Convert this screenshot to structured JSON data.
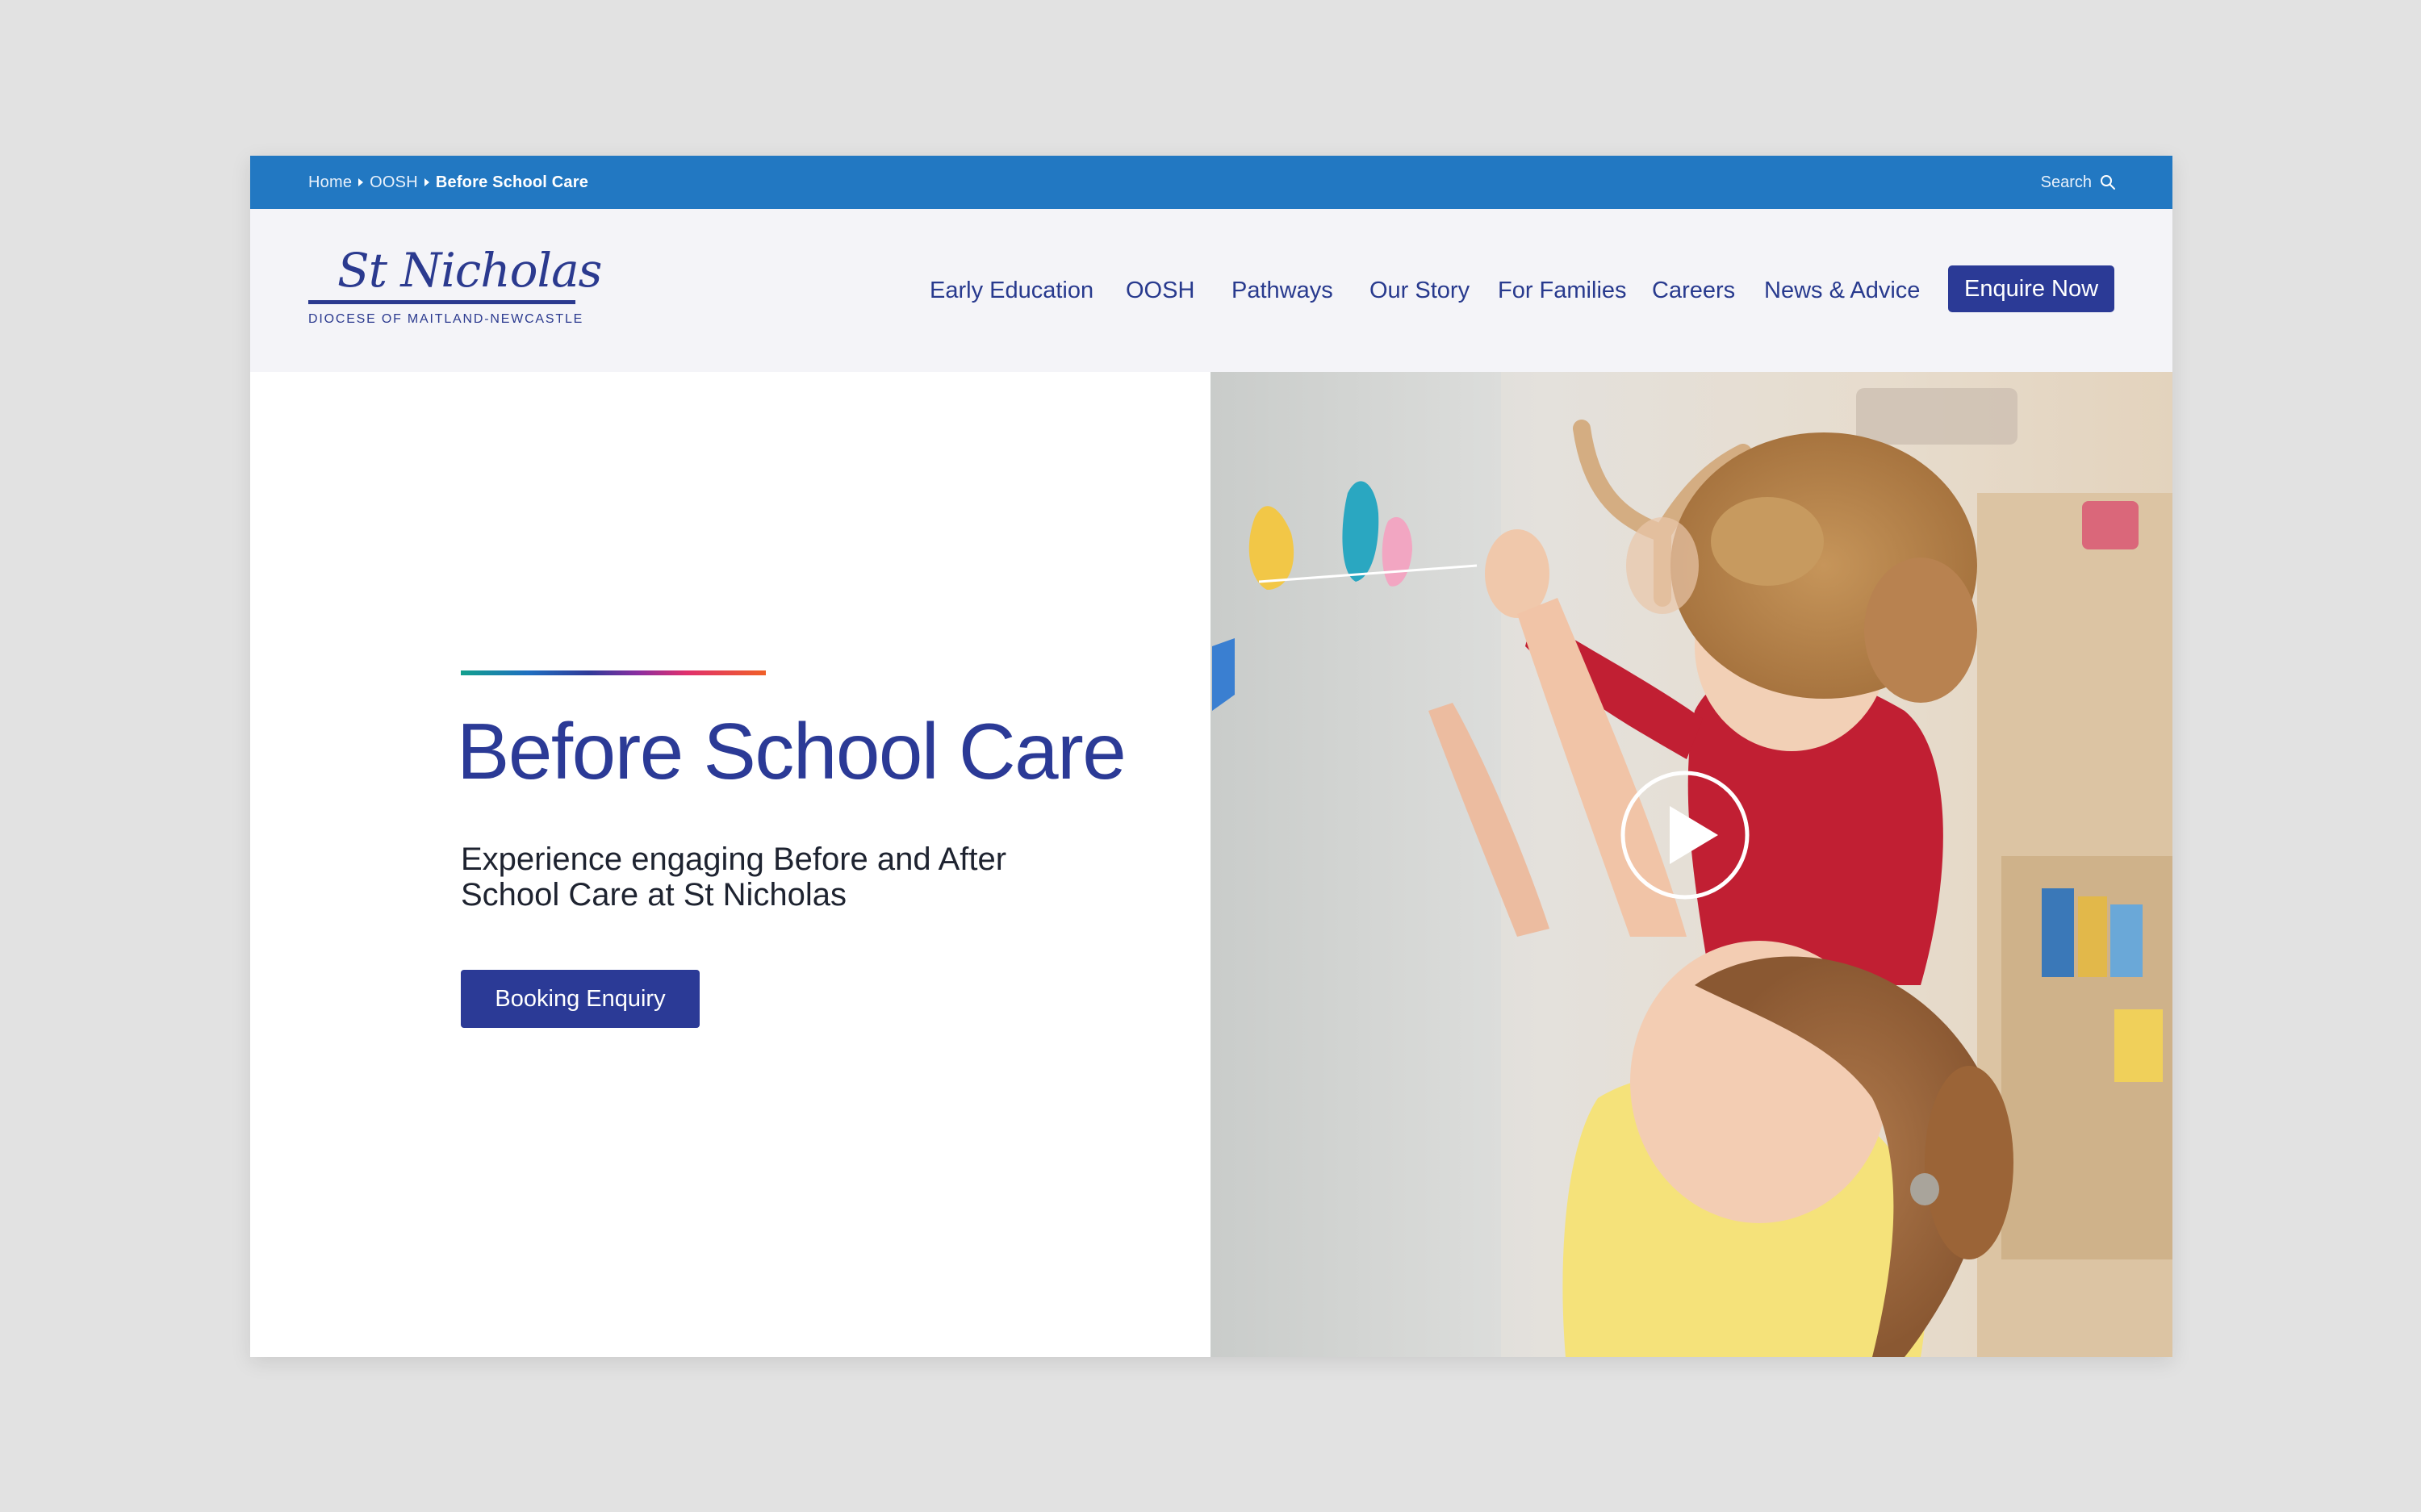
{
  "breadcrumb": {
    "home": "Home",
    "section": "OOSH",
    "current": "Before School Care"
  },
  "search": {
    "label": "Search"
  },
  "logo": {
    "name": "St Nicholas",
    "subtitle": "DIOCESE OF MAITLAND-NEWCASTLE"
  },
  "nav": {
    "items": [
      {
        "label": "Early Education"
      },
      {
        "label": "OOSH"
      },
      {
        "label": "Pathways"
      },
      {
        "label": "Our Story"
      },
      {
        "label": "For Families"
      },
      {
        "label": "Careers"
      },
      {
        "label": "News & Advice"
      }
    ],
    "cta_label": "Enquire Now"
  },
  "hero": {
    "title": "Before School Care",
    "subtitle": "Experience engaging Before and After School Care at St Nicholas",
    "button_label": "Booking Enquiry"
  },
  "colors": {
    "topbar": "#2278c2",
    "brand_navy": "#2b3a96",
    "header_bg": "#f4f4f8",
    "page_bg": "#e2e2e2"
  },
  "icons": {
    "search": "search-icon",
    "play": "play-icon"
  }
}
